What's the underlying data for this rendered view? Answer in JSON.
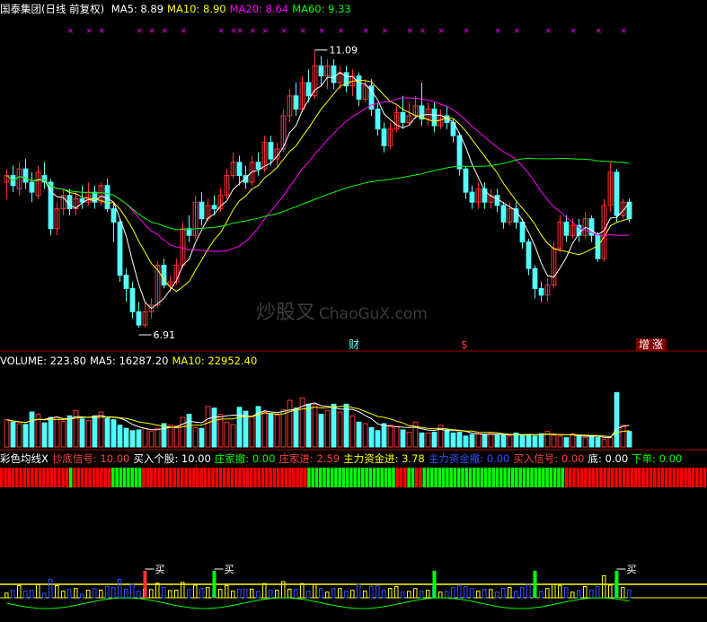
{
  "header": {
    "stock": "国泰集团(日线 前复权)",
    "ma_items": [
      {
        "label": "MA5: 8.89",
        "color": "#ffffff"
      },
      {
        "label": "MA10: 8.90",
        "color": "#ffff00"
      },
      {
        "label": "MA20: 8.64",
        "color": "#ff00ff"
      },
      {
        "label": "MA60: 9.33",
        "color": "#00ff00"
      }
    ]
  },
  "volume_legend": [
    {
      "label": "VOLUME: 223.80",
      "color": "#ffffff"
    },
    {
      "label": "MA5: 16287.20",
      "color": "#ffffff"
    },
    {
      "label": "MA10: 22952.40",
      "color": "#ffff00"
    }
  ],
  "indicator_legend": [
    {
      "label": "彩色均线X",
      "color": "#ffffff"
    },
    {
      "label": "抄底信号: 10.00",
      "color": "#ff4040"
    },
    {
      "label": "买入个股: 10.00",
      "color": "#ffffff"
    },
    {
      "label": "庄家撤: 0.00",
      "color": "#00ff00"
    },
    {
      "label": "庄家进: 2.59",
      "color": "#ff4040"
    },
    {
      "label": "主力资金进: 3.78",
      "color": "#ffff00"
    },
    {
      "label": "主力资金撤: 0.00",
      "color": "#3050ff"
    },
    {
      "label": "买入信号: 0.00",
      "color": "#ff4040"
    },
    {
      "label": "底: 0.00",
      "color": "#ffffff"
    },
    {
      "label": "下单: 0.00",
      "color": "#00ff00"
    }
  ],
  "annotations": {
    "high": "11.09",
    "low": "6.91",
    "cai": "财",
    "dollar": "$",
    "zeng": "增",
    "zhang": "涨",
    "buy": "买"
  },
  "watermark": {
    "cn": "炒股叉",
    "en": "ChaoGuX.com"
  },
  "colors": {
    "up": "#ff3232",
    "down": "#54ffff",
    "ma5": "#ffffff",
    "ma10": "#ffff00",
    "ma20": "#ff00ff",
    "ma60": "#00ff00",
    "divider": "#a00000"
  },
  "chart_data": {
    "type": "candlestick",
    "ylim": [
      6.6,
      11.6
    ],
    "candles": [
      [
        9.1,
        9.2,
        9.3,
        8.85
      ],
      [
        9.2,
        9.05,
        9.35,
        8.95
      ],
      [
        9.0,
        9.3,
        9.4,
        8.9
      ],
      [
        9.3,
        9.1,
        9.45,
        9.0
      ],
      [
        9.1,
        8.95,
        9.25,
        8.8
      ],
      [
        8.9,
        9.25,
        9.35,
        8.85
      ],
      [
        9.2,
        9.1,
        9.4,
        9.0
      ],
      [
        9.1,
        8.4,
        9.15,
        8.3
      ],
      [
        8.4,
        8.7,
        8.8,
        8.3
      ],
      [
        8.7,
        8.9,
        9.0,
        8.6
      ],
      [
        8.9,
        8.7,
        9.0,
        8.6
      ],
      [
        8.7,
        8.85,
        8.95,
        8.6
      ],
      [
        8.85,
        8.8,
        9.05,
        8.7
      ],
      [
        8.8,
        8.95,
        9.1,
        8.75
      ],
      [
        8.95,
        8.8,
        9.05,
        8.7
      ],
      [
        8.8,
        9.05,
        9.1,
        8.75
      ],
      [
        9.05,
        8.7,
        9.15,
        8.65
      ],
      [
        8.7,
        8.5,
        8.8,
        8.2
      ],
      [
        8.5,
        7.7,
        8.55,
        7.6
      ],
      [
        7.7,
        7.5,
        7.8,
        7.3
      ],
      [
        7.5,
        7.15,
        7.6,
        7.05
      ],
      [
        7.15,
        6.95,
        7.3,
        6.91
      ],
      [
        6.95,
        7.15,
        7.3,
        6.91
      ],
      [
        7.15,
        7.25,
        7.35,
        7.05
      ],
      [
        7.25,
        7.85,
        7.9,
        7.2
      ],
      [
        7.85,
        7.55,
        7.95,
        7.5
      ],
      [
        7.55,
        7.6,
        7.7,
        7.45
      ],
      [
        7.6,
        7.85,
        7.95,
        7.55
      ],
      [
        7.85,
        8.4,
        8.5,
        7.8
      ],
      [
        8.4,
        8.3,
        8.6,
        8.2
      ],
      [
        8.3,
        8.8,
        8.9,
        8.25
      ],
      [
        8.8,
        8.55,
        8.95,
        8.45
      ],
      [
        8.55,
        8.75,
        8.85,
        8.5
      ],
      [
        8.75,
        8.7,
        8.9,
        8.6
      ],
      [
        8.7,
        8.9,
        9.0,
        8.65
      ],
      [
        8.9,
        9.2,
        9.3,
        8.85
      ],
      [
        9.2,
        9.4,
        9.55,
        9.15
      ],
      [
        9.4,
        9.2,
        9.5,
        9.05
      ],
      [
        9.2,
        9.1,
        9.35,
        9.0
      ],
      [
        9.1,
        9.4,
        9.5,
        9.05
      ],
      [
        9.4,
        9.3,
        9.55,
        9.2
      ],
      [
        9.3,
        9.7,
        9.8,
        9.25
      ],
      [
        9.7,
        9.45,
        9.8,
        9.35
      ],
      [
        9.45,
        9.6,
        9.7,
        9.35
      ],
      [
        9.6,
        10.1,
        10.2,
        9.55
      ],
      [
        10.1,
        10.4,
        10.5,
        10.0
      ],
      [
        10.4,
        10.2,
        10.6,
        10.1
      ],
      [
        10.2,
        10.6,
        10.7,
        10.15
      ],
      [
        10.6,
        10.4,
        10.8,
        10.3
      ],
      [
        10.4,
        10.85,
        11.09,
        10.35
      ],
      [
        10.85,
        10.7,
        11.0,
        10.55
      ],
      [
        10.7,
        10.85,
        10.95,
        10.5
      ],
      [
        10.85,
        10.6,
        10.95,
        10.5
      ],
      [
        10.6,
        10.75,
        10.85,
        10.5
      ],
      [
        10.75,
        10.55,
        10.85,
        10.45
      ],
      [
        10.55,
        10.7,
        10.8,
        10.4
      ],
      [
        10.7,
        10.35,
        10.75,
        10.25
      ],
      [
        10.35,
        10.55,
        10.65,
        10.3
      ],
      [
        10.55,
        10.2,
        10.65,
        10.1
      ],
      [
        10.2,
        9.9,
        10.3,
        9.8
      ],
      [
        9.9,
        9.65,
        10.0,
        9.55
      ],
      [
        9.65,
        9.9,
        10.0,
        9.6
      ],
      [
        9.9,
        10.15,
        10.25,
        9.85
      ],
      [
        10.15,
        10.0,
        10.4,
        9.9
      ],
      [
        10.0,
        10.1,
        10.3,
        9.95
      ],
      [
        10.1,
        10.25,
        10.4,
        10.05
      ],
      [
        10.25,
        10.05,
        10.6,
        9.95
      ],
      [
        10.05,
        10.2,
        10.3,
        9.95
      ],
      [
        10.2,
        9.95,
        10.3,
        9.85
      ],
      [
        9.95,
        10.1,
        10.2,
        9.9
      ],
      [
        10.1,
        10.0,
        10.25,
        9.9
      ],
      [
        10.0,
        9.8,
        10.05,
        9.7
      ],
      [
        9.8,
        9.3,
        9.85,
        9.2
      ],
      [
        9.3,
        8.95,
        9.35,
        8.85
      ],
      [
        8.95,
        8.8,
        9.05,
        8.7
      ],
      [
        8.8,
        9.0,
        9.1,
        8.7
      ],
      [
        9.0,
        8.8,
        9.1,
        8.7
      ],
      [
        8.8,
        8.9,
        9.0,
        8.7
      ],
      [
        8.9,
        8.75,
        9.0,
        8.65
      ],
      [
        8.75,
        8.5,
        8.8,
        8.4
      ],
      [
        8.5,
        8.7,
        8.8,
        8.45
      ],
      [
        8.7,
        8.5,
        8.8,
        8.4
      ],
      [
        8.5,
        8.2,
        8.55,
        8.1
      ],
      [
        8.2,
        7.8,
        8.25,
        7.7
      ],
      [
        7.8,
        7.5,
        7.85,
        7.35
      ],
      [
        7.5,
        7.4,
        7.6,
        7.3
      ],
      [
        7.4,
        7.55,
        7.65,
        7.3
      ],
      [
        7.55,
        8.1,
        8.2,
        7.5
      ],
      [
        8.1,
        8.5,
        8.6,
        8.05
      ],
      [
        8.5,
        8.3,
        8.6,
        8.2
      ],
      [
        8.3,
        8.45,
        8.55,
        8.25
      ],
      [
        8.45,
        8.3,
        8.55,
        8.2
      ],
      [
        8.3,
        8.55,
        8.65,
        8.25
      ],
      [
        8.55,
        8.3,
        8.6,
        8.2
      ],
      [
        8.3,
        7.95,
        8.35,
        7.9
      ],
      [
        7.95,
        8.75,
        8.85,
        7.9
      ],
      [
        8.75,
        9.25,
        9.4,
        8.65
      ],
      [
        9.25,
        8.6,
        9.3,
        8.5
      ],
      [
        8.6,
        8.8,
        8.85,
        8.55
      ],
      [
        8.8,
        8.55,
        8.85,
        8.5
      ]
    ],
    "volume": [
      35,
      32,
      30,
      29,
      45,
      42,
      31,
      38,
      38,
      33,
      40,
      47,
      36,
      34,
      40,
      45,
      37,
      35,
      28,
      24,
      21,
      22,
      24,
      20,
      24,
      30,
      28,
      27,
      38,
      42,
      25,
      24,
      52,
      50,
      42,
      32,
      29,
      51,
      46,
      39,
      52,
      45,
      43,
      41,
      48,
      60,
      50,
      63,
      55,
      55,
      42,
      47,
      55,
      45,
      55,
      40,
      32,
      30,
      25,
      21,
      30,
      28,
      26,
      22,
      19,
      32,
      18,
      18,
      19,
      28,
      22,
      18,
      19,
      14,
      16,
      17,
      16,
      18,
      15,
      15,
      14,
      18,
      16,
      16,
      14,
      17,
      20,
      15,
      14,
      12,
      17,
      14,
      12,
      14,
      12,
      10,
      12,
      70,
      28,
      20,
      38,
      62,
      62,
      32,
      58,
      90,
      40,
      35,
      32,
      20
    ],
    "indicator_bars": [
      1,
      1,
      1,
      1,
      1,
      1,
      1,
      1,
      1,
      1,
      1,
      1,
      1,
      1,
      1,
      1,
      1,
      1,
      0,
      1,
      1,
      1,
      1,
      1,
      1,
      1,
      1,
      1,
      1,
      0,
      0,
      0,
      0,
      0,
      0,
      0,
      0,
      1,
      1,
      1,
      1,
      1,
      1,
      1,
      1,
      1,
      1,
      1,
      1,
      1,
      1,
      1,
      1,
      1,
      1,
      1,
      1,
      1,
      1,
      1,
      1,
      1,
      1,
      1,
      1,
      1,
      1,
      1,
      1,
      1,
      1,
      1,
      1,
      1,
      1,
      1,
      1,
      1,
      1,
      1,
      0,
      0,
      0,
      0,
      0,
      0,
      0,
      0,
      0,
      0,
      0,
      0,
      0,
      0,
      0,
      0,
      0,
      0,
      0,
      0,
      0,
      0,
      0,
      1,
      1,
      1,
      0,
      0,
      1,
      1,
      0,
      0,
      0,
      0,
      0,
      0,
      0,
      0,
      0,
      0,
      0,
      0,
      0,
      0,
      0,
      0,
      0,
      0,
      0,
      0,
      0,
      0,
      0,
      0,
      0,
      0,
      0,
      0,
      0,
      0,
      0,
      0,
      0,
      0,
      0,
      0,
      0,
      1,
      1,
      1,
      1,
      1,
      1,
      1,
      1,
      1,
      1,
      1,
      1,
      1,
      1,
      1,
      1,
      1,
      1,
      1,
      1,
      1,
      1,
      1,
      1,
      1,
      1,
      1,
      1,
      1,
      1,
      1,
      1,
      1,
      1,
      1,
      1,
      1
    ]
  }
}
